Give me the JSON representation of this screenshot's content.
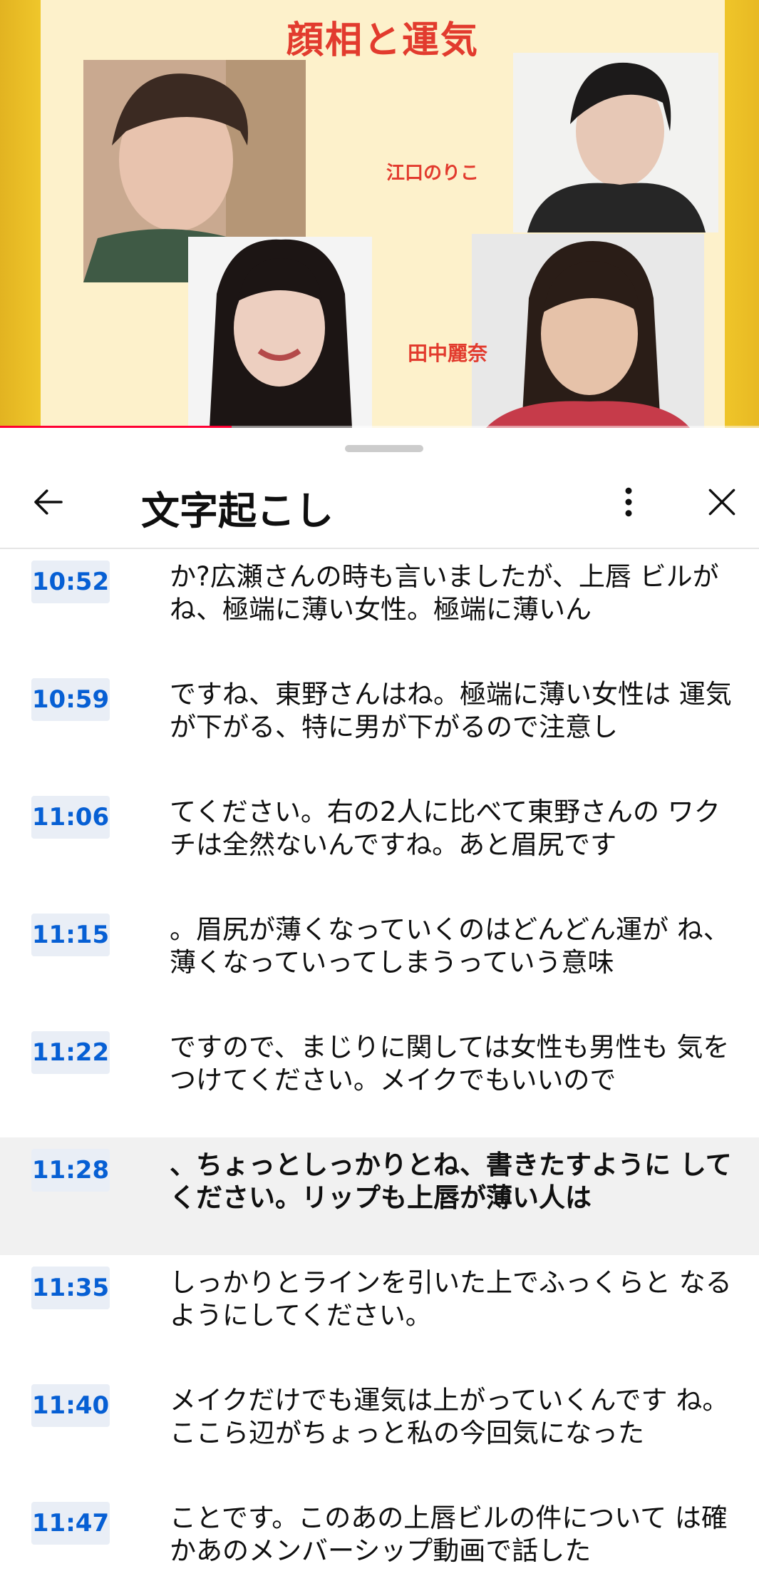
{
  "video": {
    "slide_title": "顔相と運気",
    "name_1": "江口のりこ",
    "name_2": "田中麗奈",
    "progress": 0.305
  },
  "sheet": {
    "title": "文字起こし"
  },
  "transcript": [
    {
      "time": "10:52",
      "text": "か?広瀬さんの時も言いましたが、上唇 ビルがね、極端に薄い女性。極端に薄いん"
    },
    {
      "time": "10:59",
      "text": "ですね、東野さんはね。極端に薄い女性は 運気が下がる、特に男が下がるので注意し"
    },
    {
      "time": "11:06",
      "text": "てください。右の2人に比べて東野さんの ワクチは全然ないんですね。あと眉尻です"
    },
    {
      "time": "11:15",
      "text": "。眉尻が薄くなっていくのはどんどん運が ね、薄くなっていってしまうっていう意味"
    },
    {
      "time": "11:22",
      "text": "ですので、まじりに関しては女性も男性も 気をつけてください。メイクでもいいので"
    },
    {
      "time": "11:28",
      "text": "、ちょっとしっかりとね、書きたすように してください。リップも上唇が薄い人は",
      "active": true
    },
    {
      "time": "11:35",
      "text": "しっかりとラインを引いた上でふっくらと なるようにしてください。"
    },
    {
      "time": "11:40",
      "text": "メイクだけでも運気は上がっていくんです ね。 ここら辺がちょっと私の今回気になった"
    },
    {
      "time": "11:47",
      "text": "ことです。このあの上唇ビルの件について は確かあのメンバーシップ動画で話した"
    }
  ]
}
